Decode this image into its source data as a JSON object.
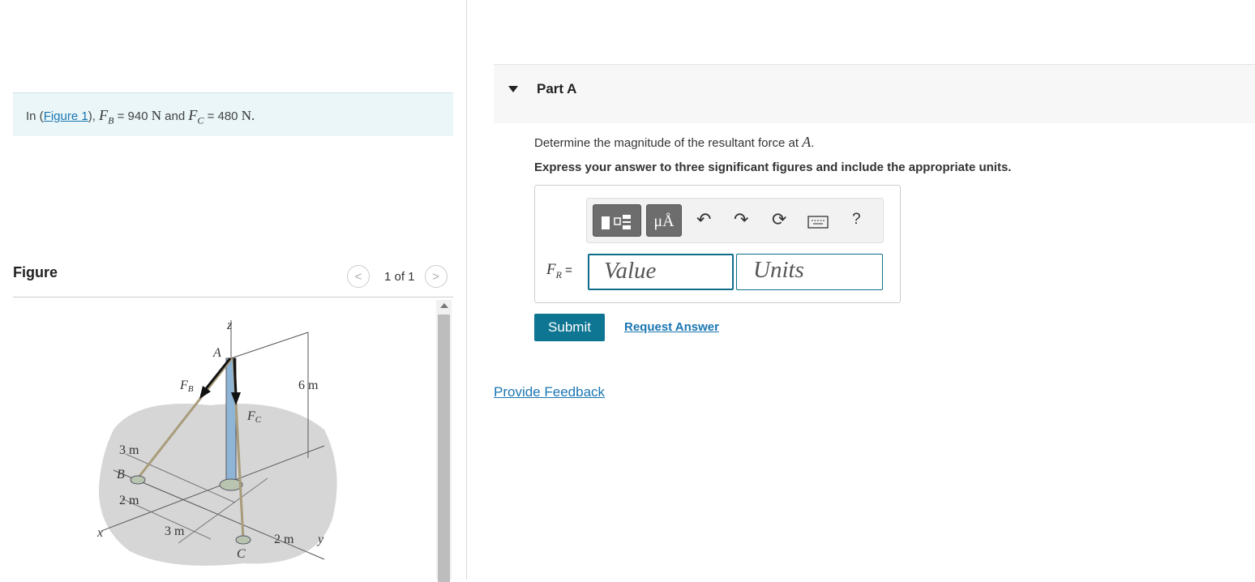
{
  "intro": {
    "prefix": "In (",
    "figure_link": "Figure 1",
    "suffix": "),",
    "fb_symbol": "F",
    "fb_sub": "B",
    "fb_eq": "= 940",
    "fb_unit": "N",
    "and": "and",
    "fc_symbol": "F",
    "fc_sub": "C",
    "fc_eq": "= 480",
    "fc_unit": "N",
    "end": "."
  },
  "figure_panel": {
    "title": "Figure",
    "pager_text": "1 of 1",
    "prev_glyph": "<",
    "next_glyph": ">",
    "labels": {
      "z": "z",
      "A": "A",
      "FB": "F",
      "FB_sub": "B",
      "FC": "F",
      "FC_sub": "C",
      "six_m": "6 m",
      "three_m_top": "3 m",
      "B": "B",
      "two_m_left": "2 m",
      "x": "x",
      "three_m_bottom": "3 m",
      "C": "C",
      "two_m_bottom": "2 m",
      "y": "y"
    }
  },
  "part": {
    "title": "Part A",
    "question": "Determine the magnitude of the resultant force at",
    "question_point": "A",
    "question_end": ".",
    "instruction": "Express your answer to three significant figures and include the appropriate units."
  },
  "answer": {
    "label_symbol": "F",
    "label_sub": "R",
    "label_eq": "=",
    "value_placeholder": "Value",
    "units_placeholder": "Units",
    "units_button_text": "μÅ",
    "help_text": "?"
  },
  "actions": {
    "submit": "Submit",
    "request_answer": "Request Answer",
    "feedback": "Provide Feedback"
  },
  "colors": {
    "teal": "#0e7593",
    "link": "#1a76b2",
    "intro_bg": "#eaf6f8"
  }
}
